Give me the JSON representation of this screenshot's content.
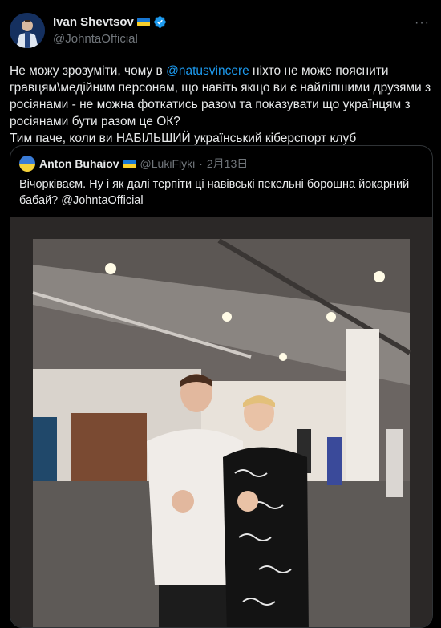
{
  "tweet": {
    "display_name": "Ivan Shevtsov",
    "handle": "@JohntaOfficial",
    "more_label": "···",
    "text_before_mention": "Не можу зрозуміти, чому в ",
    "mention": "@natusvincere",
    "text_after_mention": " ніхто не може пояснити гравцям\\медійним персонам, що навіть якщо ви є найліпшими друзями з росіянами - не можна фоткатись разом та показувати що українцям з росіянами бути разом це ОК?",
    "text_line_2": "Тим паче, коли ви НАБІЛЬШИЙ український кіберспорт клуб"
  },
  "quote": {
    "display_name": "Anton Buhaiov",
    "handle": "@LukiFlyki",
    "separator": " · ",
    "date": "2月13日",
    "text": "Вічорківаєм. Ну і як далі терпіти ці навівські пекельні борошна йокарний бабай? @JohntaOfficial"
  },
  "colors": {
    "background": "#000000",
    "text": "#e7e9ea",
    "secondary": "#71767b",
    "link": "#1d9bf0",
    "border": "#2f3336",
    "verified": "#1d9bf0"
  },
  "icons": {
    "verified": "verified-badge-icon",
    "flag": "ukraine-flag-icon",
    "more": "more-icon"
  }
}
